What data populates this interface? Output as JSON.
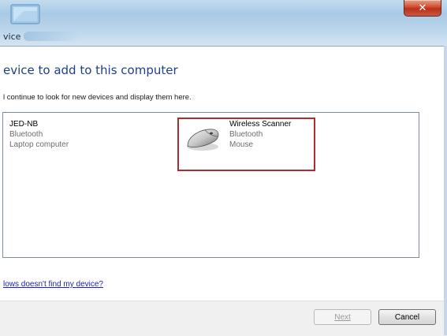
{
  "window": {
    "title": "vice",
    "close_glyph": "✕"
  },
  "content": {
    "heading": "evice to add to this computer",
    "subtext": "l continue to look for new devices and display them here."
  },
  "devices": [
    {
      "name": "JED-NB",
      "type": "Bluetooth",
      "category": "Laptop computer",
      "icon": "none"
    },
    {
      "name": "Wireless Scanner",
      "type": "Bluetooth",
      "category": "Mouse",
      "icon": "mouse-icon",
      "selected": true,
      "highlight_color": "#b02a2e"
    }
  ],
  "help_link": "lows doesn't find my device?",
  "buttons": {
    "next": "Next",
    "cancel": "Cancel"
  },
  "colors": {
    "heading": "#1e3f8a",
    "link": "#2222aa"
  }
}
